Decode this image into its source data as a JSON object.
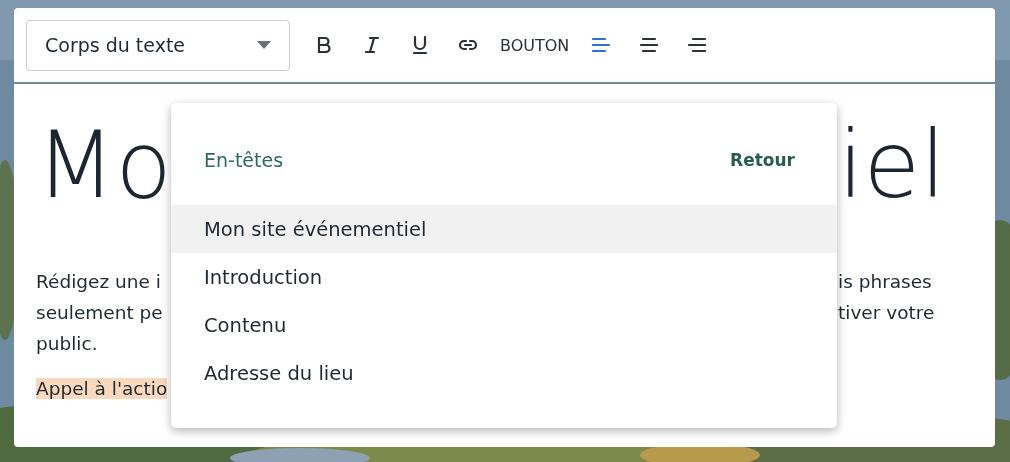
{
  "toolbar": {
    "style_select": {
      "value": "Corps du texte"
    },
    "buttons": [
      {
        "kind": "bold",
        "selected": false
      },
      {
        "kind": "italic",
        "selected": false
      },
      {
        "kind": "underline",
        "selected": false
      },
      {
        "kind": "link",
        "selected": false
      },
      {
        "kind": "text",
        "label": "BOUTON",
        "selected": false
      },
      {
        "kind": "align-left",
        "selected": true
      },
      {
        "kind": "align-center",
        "selected": false
      },
      {
        "kind": "align-right",
        "selected": false
      }
    ]
  },
  "editor": {
    "heading": {
      "left": "Mo",
      "right": "iel"
    },
    "paragraph_lines": [
      {
        "left": "Rédigez une i",
        "right": "is phrases"
      },
      {
        "left": "seulement pe",
        "right": "tiver votre"
      },
      {
        "left": "public."
      }
    ],
    "highlighted_text": "Appel à l'actio"
  },
  "dropdown": {
    "title": "En-têtes",
    "back_link": "Retour",
    "items": [
      {
        "label": "Mon site événementiel",
        "selected": true
      },
      {
        "label": "Introduction",
        "selected": false
      },
      {
        "label": "Contenu",
        "selected": false
      },
      {
        "label": "Adresse du lieu",
        "selected": false
      }
    ]
  }
}
